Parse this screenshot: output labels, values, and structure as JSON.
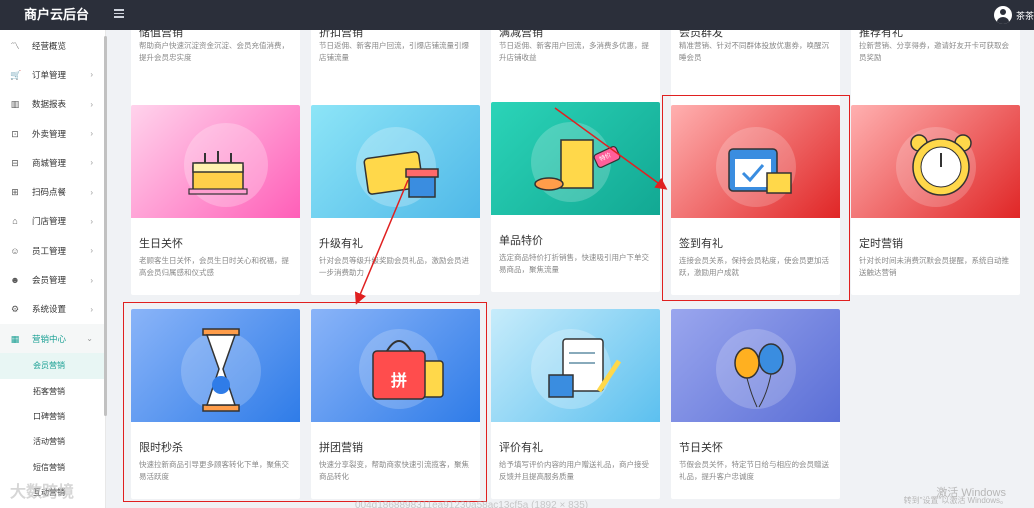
{
  "app": {
    "title": "商户云后台",
    "username": "茶茶"
  },
  "sidebar": {
    "items": [
      {
        "label": "经营概览",
        "icon": "chart-line-icon",
        "glyph": "〽"
      },
      {
        "label": "订单管理",
        "icon": "cart-icon",
        "glyph": "🛒"
      },
      {
        "label": "数据报表",
        "icon": "bar-chart-icon",
        "glyph": "▥"
      },
      {
        "label": "外卖管理",
        "icon": "takeaway-icon",
        "glyph": "⊡"
      },
      {
        "label": "商城管理",
        "icon": "shop-icon",
        "glyph": "⊟"
      },
      {
        "label": "扫码点餐",
        "icon": "scan-icon",
        "glyph": "⊞"
      },
      {
        "label": "门店管理",
        "icon": "store-icon",
        "glyph": "⌂"
      },
      {
        "label": "员工管理",
        "icon": "staff-icon",
        "glyph": "☺"
      },
      {
        "label": "会员管理",
        "icon": "member-icon",
        "glyph": "☻"
      },
      {
        "label": "系统设置",
        "icon": "gear-icon",
        "glyph": "⚙"
      },
      {
        "label": "营销中心",
        "icon": "grid-icon",
        "glyph": "▦"
      }
    ],
    "subitems": [
      "会员营销",
      "拓客营销",
      "口碑营销",
      "活动营销",
      "短信营销",
      "互动营销"
    ]
  },
  "cards_top": [
    {
      "title": "储值营销",
      "desc": "帮助商户快速沉淀资金沉淀、会员充值消费，提升会员忠实度"
    },
    {
      "title": "折扣营销",
      "desc": "节日返佣、新客用户回流，引爆店铺流量引爆店铺流量"
    },
    {
      "title": "满减营销",
      "desc": "节日返佣、新客用户回流，多消费多优惠，提升店铺收益"
    },
    {
      "title": "会员群发",
      "desc": "精准营销、针对不同群体投放优惠券，唤醒沉睡会员"
    },
    {
      "title": "推荐有礼",
      "desc": "拉新营销、分享得券，邀请好友开卡可获取会员奖励"
    }
  ],
  "cards_row2": [
    {
      "title": "生日关怀",
      "desc": "老顾客生日关怀，会员生日时关心和祝福，提高会员归属感和仪式感"
    },
    {
      "title": "升级有礼",
      "desc": "针对会员等级升级奖励会员礼品，激励会员进一步消费助力"
    },
    {
      "title": "单品特价",
      "desc": "选定商品特价打折销售，快速吸引用户下单交易商品，聚焦流量"
    },
    {
      "title": "签到有礼",
      "desc": "连接会员关系，保持会员粘度，使会员更加活跃，激励用户成就"
    },
    {
      "title": "定时营销",
      "desc": "针对长时间未消费沉默会员提醒，系统自动推送触达营销"
    }
  ],
  "cards_row3": [
    {
      "title": "限时秒杀",
      "desc": "快速拉新商品引导更多顾客转化下单，聚焦交易活跃度"
    },
    {
      "title": "拼团营销",
      "desc": "快速分享裂变，帮助商家快速引流揽客，聚焦商品转化"
    },
    {
      "title": "评价有礼",
      "desc": "给予填写评价内容的用户赠送礼品，商户接受反馈并且提高服务质量"
    },
    {
      "title": "节日关怀",
      "desc": "节假会员关怀，特定节日给与相应的会员赠送礼品，提升客户忠诚度"
    }
  ],
  "pin_badge": "拼",
  "tag_badge": "特价",
  "watermark": {
    "line1": "激活 Windows",
    "line2": "转到\"设置\"以激活 Windows。"
  },
  "logo_watermark": "大数跨境",
  "id_watermark": "004d1868898311ea91230a58ac13cf5a (1892 × 835)"
}
